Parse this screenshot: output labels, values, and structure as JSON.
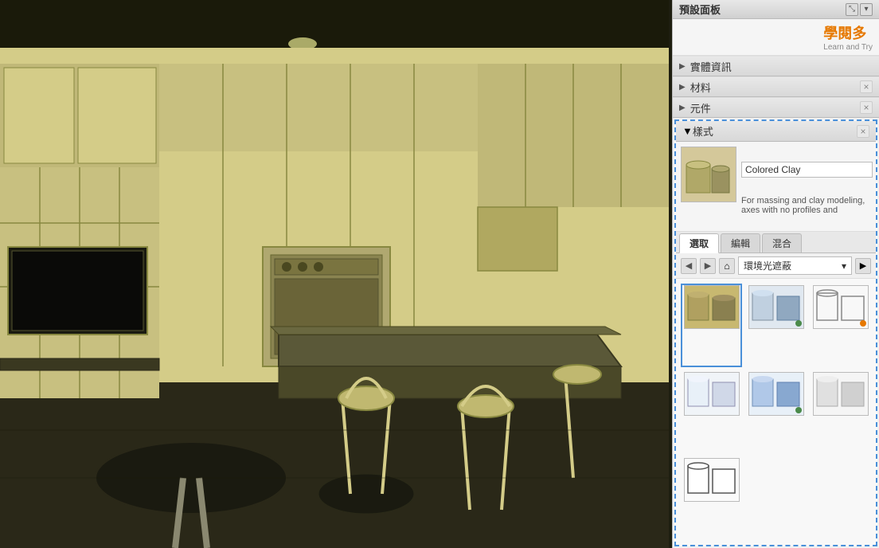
{
  "panel": {
    "title": "預設面板",
    "logo": "學閱多",
    "logo_sub": "Learn and Try"
  },
  "sections": {
    "entity_info": "實體資訊",
    "materials": "材料",
    "components": "元件",
    "styles": "樣式"
  },
  "style": {
    "name": "Colored Clay",
    "description": "For massing and clay modeling, axes with no profiles and",
    "description_full": "For massing and clay modeling, axes with no profiles and"
  },
  "tabs": {
    "select": "選取",
    "edit": "編輯",
    "mix": "混合"
  },
  "nav": {
    "dropdown_label": "環境光遮蔽"
  },
  "thumbnails": [
    {
      "id": 1,
      "selected": true,
      "dot": "none"
    },
    {
      "id": 2,
      "selected": false,
      "dot": "green"
    },
    {
      "id": 3,
      "selected": false,
      "dot": "orange"
    },
    {
      "id": 4,
      "selected": false,
      "dot": "none"
    },
    {
      "id": 5,
      "selected": false,
      "dot": "green"
    },
    {
      "id": 6,
      "selected": false,
      "dot": "none"
    },
    {
      "id": 7,
      "selected": false,
      "dot": "none"
    }
  ],
  "buttons": {
    "close": "×",
    "back": "◀",
    "forward": "▶",
    "home": "⌂",
    "go": "▶",
    "arrow_down": "▾",
    "update": "↻",
    "save_new": "💾",
    "create": "+"
  }
}
